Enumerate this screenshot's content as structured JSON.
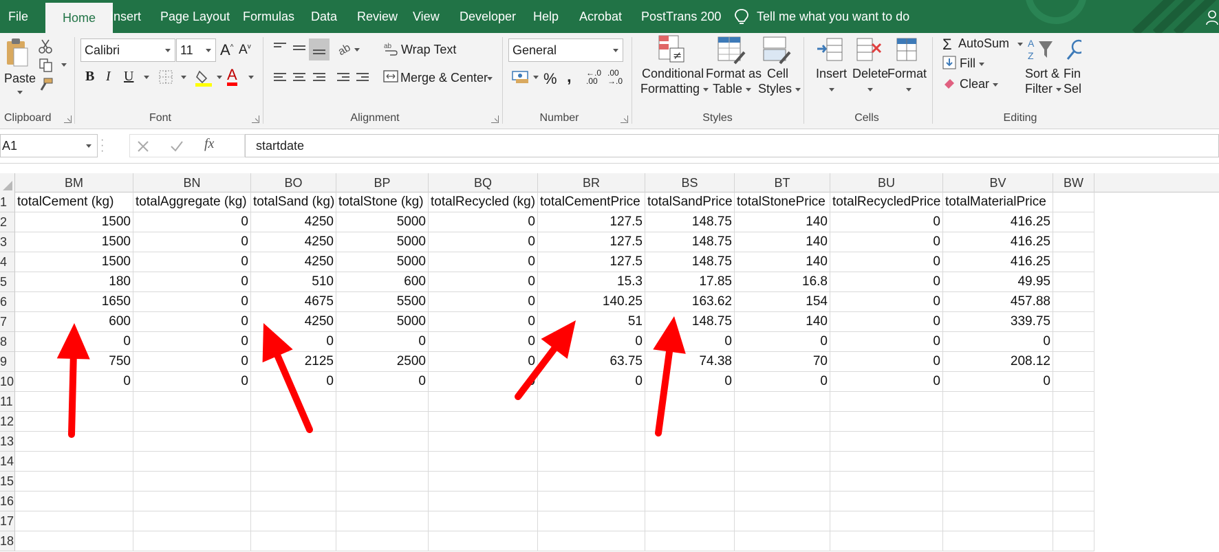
{
  "menu": {
    "tabs": [
      "File",
      "Home",
      "Insert",
      "Page Layout",
      "Formulas",
      "Data",
      "Review",
      "View",
      "Developer",
      "Help",
      "Acrobat",
      "PostTrans 200"
    ],
    "active": "Home",
    "tell_me": "Tell me what you want to do",
    "accent_color": "#217346"
  },
  "ribbon": {
    "clipboard": {
      "paste": "Paste",
      "label": "Clipboard"
    },
    "font": {
      "name": "Calibri",
      "size": "11",
      "bold": "B",
      "italic": "I",
      "underline": "U",
      "grow": "A",
      "shrink": "A",
      "color_letter": "A",
      "label": "Font"
    },
    "alignment": {
      "wrap_text": "Wrap Text",
      "merge_center": "Merge & Center",
      "label": "Alignment"
    },
    "number": {
      "format": "General",
      "percent": "%",
      "comma": ",",
      "inc_decimal": "←.0 .00",
      "dec_decimal": ".00 →.0",
      "label": "Number"
    },
    "styles": {
      "conditional": [
        "Conditional",
        "Formatting"
      ],
      "format_table": [
        "Format as",
        "Table"
      ],
      "cell_styles": [
        "Cell",
        "Styles"
      ],
      "label": "Styles"
    },
    "cells": {
      "insert": "Insert",
      "delete": "Delete",
      "format": "Format",
      "label": "Cells"
    },
    "editing": {
      "autosum": "AutoSum",
      "fill": "Fill",
      "clear": "Clear",
      "sort": [
        "Sort &",
        "Filter"
      ],
      "find": [
        "Fin",
        "Sele"
      ],
      "label": "Editing"
    }
  },
  "formula_bar": {
    "name_box": "A1",
    "fx": "fx",
    "value": "startdate"
  },
  "sheet": {
    "columns": [
      "BM",
      "BN",
      "BO",
      "BP",
      "BQ",
      "BR",
      "BS",
      "BT",
      "BU",
      "BV",
      "BW"
    ],
    "row_numbers": [
      "1",
      "2",
      "3",
      "4",
      "5",
      "6",
      "7",
      "8",
      "9",
      "10",
      "11",
      "12",
      "13",
      "14",
      "15",
      "16",
      "17",
      "18"
    ],
    "header_row": [
      "totalCement (kg)",
      "totalAggregate (kg)",
      "totalSand (kg)",
      "totalStone (kg)",
      "totalRecycled (kg)",
      "totalCementPrice",
      "totalSandPrice",
      "totalStonePrice",
      "totalRecycledPrice",
      "totalMaterialPrice",
      ""
    ],
    "rows": [
      [
        "1500",
        "0",
        "4250",
        "5000",
        "0",
        "127.5",
        "148.75",
        "140",
        "0",
        "416.25",
        ""
      ],
      [
        "1500",
        "0",
        "4250",
        "5000",
        "0",
        "127.5",
        "148.75",
        "140",
        "0",
        "416.25",
        ""
      ],
      [
        "1500",
        "0",
        "4250",
        "5000",
        "0",
        "127.5",
        "148.75",
        "140",
        "0",
        "416.25",
        ""
      ],
      [
        "180",
        "0",
        "510",
        "600",
        "0",
        "15.3",
        "17.85",
        "16.8",
        "0",
        "49.95",
        ""
      ],
      [
        "1650",
        "0",
        "4675",
        "5500",
        "0",
        "140.25",
        "163.62",
        "154",
        "0",
        "457.88",
        ""
      ],
      [
        "600",
        "0",
        "4250",
        "5000",
        "0",
        "51",
        "148.75",
        "140",
        "0",
        "339.75",
        ""
      ],
      [
        "0",
        "0",
        "0",
        "0",
        "0",
        "0",
        "0",
        "0",
        "0",
        "0",
        ""
      ],
      [
        "750",
        "0",
        "2125",
        "2500",
        "0",
        "63.75",
        "74.38",
        "70",
        "0",
        "208.12",
        ""
      ],
      [
        "0",
        "0",
        "0",
        "0",
        "0",
        "0",
        "0",
        "0",
        "0",
        "0",
        ""
      ]
    ]
  },
  "annotations": {
    "arrow_color": "#ff0000"
  }
}
